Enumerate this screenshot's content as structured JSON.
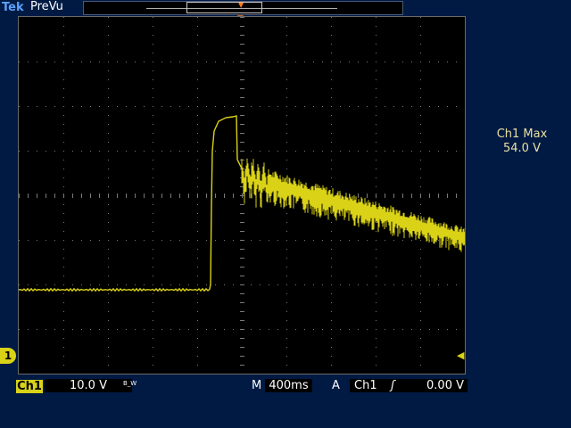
{
  "header": {
    "brand": "Tek",
    "mode": "PreVu"
  },
  "measurement": {
    "label": "Ch1 Max",
    "value": "54.0 V"
  },
  "channel": {
    "name": "Ch1",
    "marker": "1",
    "scale": "10.0 V",
    "bw_limit": "B_W"
  },
  "timebase": {
    "prefix": "M",
    "value": "400ms"
  },
  "trigger": {
    "mode": "A",
    "source": "Ch1",
    "slope": "ʃ",
    "level": "0.00 V"
  },
  "colors": {
    "trace": "#d9d216",
    "graticule": "#7a7a7a",
    "trigger_marker": "#ff7a1a"
  },
  "icons": {
    "trigger_position": "trigger-position-icon",
    "ground_marker": "channel-ground-icon",
    "level_arrow": "trigger-level-arrow-icon"
  }
}
